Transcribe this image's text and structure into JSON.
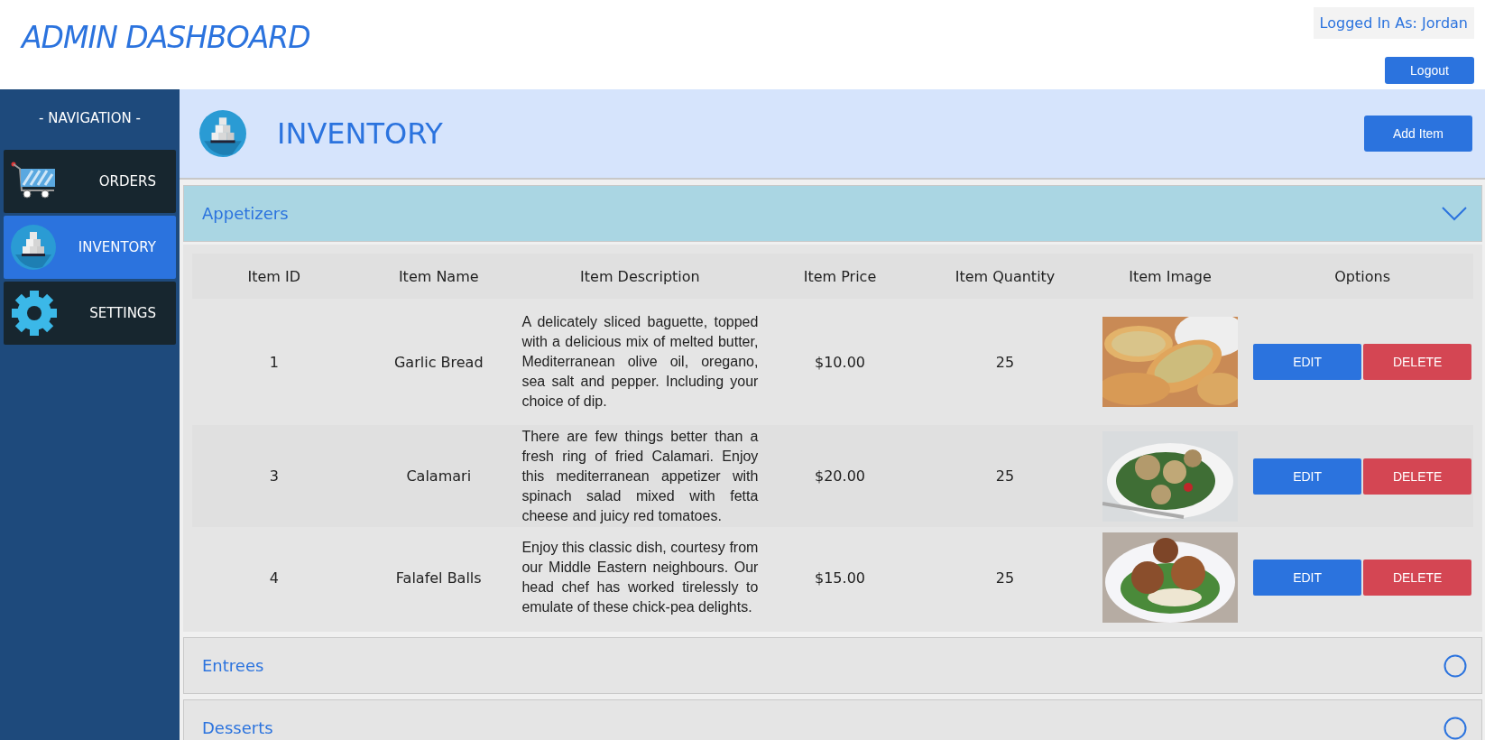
{
  "header": {
    "title": "ADMIN DASHBOARD",
    "user": "Logged In As: Jordan",
    "logout": "Logout"
  },
  "sidebar": {
    "heading": "- NAVIGATION -",
    "items": [
      {
        "label": "ORDERS",
        "selected": false
      },
      {
        "label": "INVENTORY",
        "selected": true
      },
      {
        "label": "SETTINGS",
        "selected": false
      }
    ]
  },
  "page": {
    "title": "INVENTORY",
    "add_button": "Add Item"
  },
  "sections": [
    {
      "title": "Appetizers",
      "expanded": true,
      "table": {
        "columns": [
          "Item ID",
          "Item Name",
          "Item Description",
          "Item Price",
          "Item Quantity",
          "Item Image",
          "Options"
        ],
        "rows": [
          {
            "id": "1",
            "name": "Garlic Bread",
            "description": "A delicately sliced baguette, topped with a delicious mix of melted butter, Mediterranean olive oil, oregano, sea salt and pepper. Including your choice of dip.",
            "price": "$10.00",
            "quantity": "25",
            "edit": "EDIT",
            "delete": "DELETE"
          },
          {
            "id": "3",
            "name": "Calamari",
            "description": "There are few things better than a fresh ring of fried Calamari. Enjoy this mediterranean appetizer with spinach salad mixed with fetta cheese and juicy red tomatoes.",
            "price": "$20.00",
            "quantity": "25",
            "edit": "EDIT",
            "delete": "DELETE"
          },
          {
            "id": "4",
            "name": "Falafel Balls",
            "description": "Enjoy this classic dish, courtesy from our Middle Eastern neighbours. Our head chef has worked tirelessly to emulate of these chick-pea delights.",
            "price": "$15.00",
            "quantity": "25",
            "edit": "EDIT",
            "delete": "DELETE"
          }
        ]
      }
    },
    {
      "title": "Entrees",
      "expanded": false
    },
    {
      "title": "Desserts",
      "expanded": false
    }
  ]
}
